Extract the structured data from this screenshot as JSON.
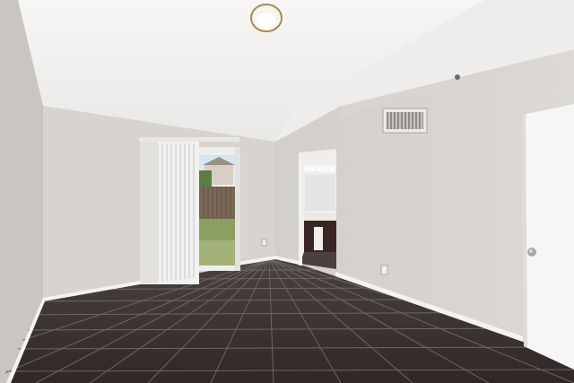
{
  "scene": {
    "colors": {
      "ceiling": "#f2f1ef",
      "wall_left": "#cfccc7",
      "wall_back": "#d9d6d1",
      "wall_right": "#d6d3ce",
      "floor_tile": "#3b3432",
      "grout": "#6b6461",
      "baseboard": "#f4f3f1",
      "door": "#f6f6f6"
    },
    "icons": [
      "ceiling-light-icon",
      "air-vent-icon",
      "outlet-icon",
      "door-knob-icon"
    ]
  }
}
